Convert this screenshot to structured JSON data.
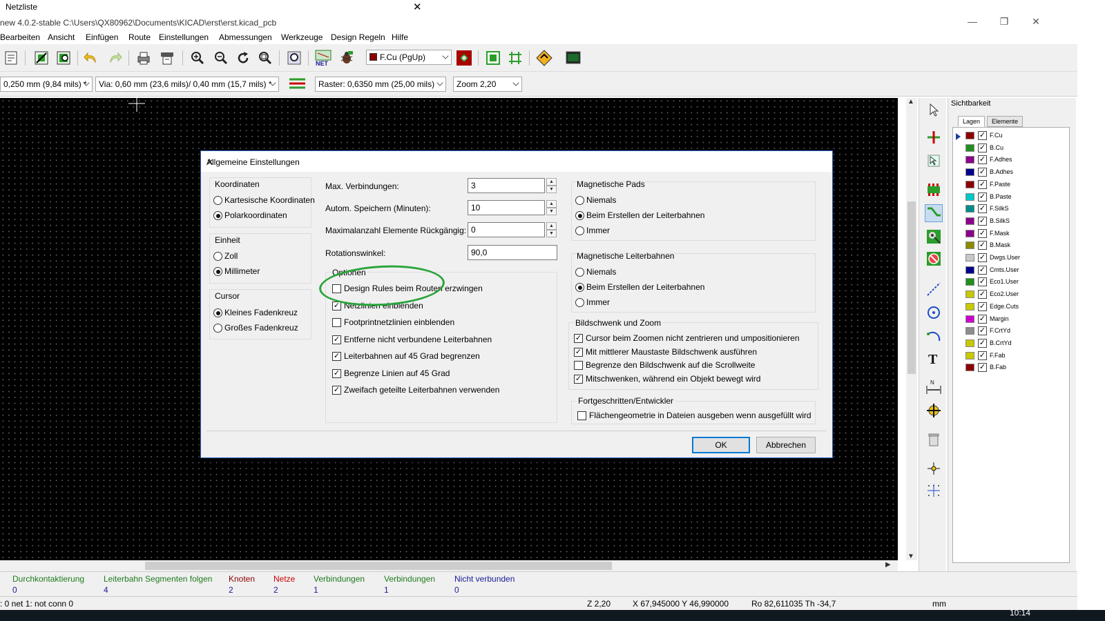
{
  "netzliste_window": {
    "title": "Netzliste",
    "close": "✕"
  },
  "window": {
    "title": "new 4.0.2-stable C:\\Users\\QX80962\\Documents\\KICAD\\erst\\erst.kicad_pcb",
    "minimize": "—",
    "restore": "❐",
    "close": "✕"
  },
  "menu": [
    "Bearbeiten",
    "Ansicht",
    "Einfügen",
    "Route",
    "Einstellungen",
    "Abmessungen",
    "Werkzeuge",
    "Design Regeln",
    "Hilfe"
  ],
  "toolbar1": {
    "layer_select": "F.Cu (PgUp)",
    "layer_color": "#8b0000",
    "icons": [
      "page-settings-icon",
      "library-editor-icon",
      "library-browser-icon",
      "undo-icon",
      "redo-icon",
      "print-icon",
      "plot-icon",
      "zoom-in-icon",
      "zoom-out-icon",
      "redraw-icon",
      "zoom-fit-icon",
      "find-icon",
      "netlist-icon",
      "drc-icon",
      "layer-pair-icon",
      "autoplace-icon",
      "grid-icon",
      "autoroute-icon",
      "scripting-console-icon"
    ]
  },
  "toolbar2": {
    "track_width": "0,250 mm (9,84 mils) *",
    "via_size": "Via: 0,60 mm (23,6 mils)/ 0,40 mm (15,7 mils) *",
    "grid": "Raster: 0,6350 mm (25,00 mils)",
    "zoom": "Zoom 2,20"
  },
  "right_tools": [
    "select-arrow-icon",
    "highlight-net-icon",
    "local-ratsnest-icon",
    "add-footprint-icon",
    "route-track-icon",
    "add-via-icon",
    "keepout-icon",
    "graphic-line-icon",
    "circle-icon",
    "arc-icon",
    "text-icon",
    "dimension-icon",
    "target-icon",
    "delete-icon",
    "drill-origin-icon",
    "grid-origin-icon"
  ],
  "layers_panel": {
    "title": "Sichtbarkeit",
    "tabs": [
      "Lagen",
      "Elemente"
    ],
    "layers": [
      {
        "name": "F.Cu",
        "color": "#8b0000"
      },
      {
        "name": "B.Cu",
        "color": "#1f8f1f"
      },
      {
        "name": "F.Adhes",
        "color": "#8b008b"
      },
      {
        "name": "B.Adhes",
        "color": "#00008b"
      },
      {
        "name": "F.Paste",
        "color": "#8b0000"
      },
      {
        "name": "B.Paste",
        "color": "#00c8c8"
      },
      {
        "name": "F.SilkS",
        "color": "#008b8b"
      },
      {
        "name": "B.SilkS",
        "color": "#8b008b"
      },
      {
        "name": "F.Mask",
        "color": "#8b008b"
      },
      {
        "name": "B.Mask",
        "color": "#8b8b00"
      },
      {
        "name": "Dwgs.User",
        "color": "#c8c8c8"
      },
      {
        "name": "Cmts.User",
        "color": "#00008b"
      },
      {
        "name": "Eco1.User",
        "color": "#1f8f1f"
      },
      {
        "name": "Eco2.User",
        "color": "#c8c800"
      },
      {
        "name": "Edge.Cuts",
        "color": "#c8c800"
      },
      {
        "name": "Margin",
        "color": "#c800c8"
      },
      {
        "name": "F.CrtYd",
        "color": "#8c8c8c"
      },
      {
        "name": "B.CrtYd",
        "color": "#c8c800"
      },
      {
        "name": "F.Fab",
        "color": "#c8c800"
      },
      {
        "name": "B.Fab",
        "color": "#8b0000"
      }
    ]
  },
  "status_bar": {
    "cells": [
      {
        "label": "Durchkontaktierung",
        "value": "0",
        "color": "#1e7a1e"
      },
      {
        "label": "Leiterbahn Segmenten folgen",
        "value": "4",
        "color": "#1e7a1e"
      },
      {
        "label": "Knoten",
        "value": "2",
        "color": "#8b0000"
      },
      {
        "label": "Netze",
        "value": "2",
        "color": "#cc0000"
      },
      {
        "label": "Verbindungen",
        "value": "1",
        "color": "#1e7a1e"
      },
      {
        "label": "Verbindungen",
        "value": "1",
        "color": "#1e7a1e"
      },
      {
        "label": "Nicht verbunden",
        "value": "0",
        "color": "#1a1a99"
      }
    ],
    "line2_left": ": 0  net 1: not conn 0",
    "zoom": "Z 2,20",
    "coords": "X 67,945000  Y 46,990000",
    "polar": "Ro 82,611035  Th -34,7",
    "units": "mm"
  },
  "taskbar": {
    "clock": "10:14"
  },
  "dialog": {
    "title": "Allgemeine Einstellungen",
    "close": "✕",
    "koordinaten": {
      "title": "Koordinaten",
      "options": [
        "Kartesische Koordinaten",
        "Polarkoordinaten"
      ],
      "selected": 1
    },
    "einheit": {
      "title": "Einheit",
      "options": [
        "Zoll",
        "Millimeter"
      ],
      "selected": 1
    },
    "cursor": {
      "title": "Cursor",
      "options": [
        "Kleines Fadenkreuz",
        "Großes Fadenkreuz"
      ],
      "selected": 0
    },
    "fields": [
      {
        "label": "Max. Verbindungen:",
        "value": "3",
        "spin": true
      },
      {
        "label": "Autom. Speichern (Minuten):",
        "value": "10",
        "spin": true
      },
      {
        "label": "Maximalanzahl Elemente Rückgängig:",
        "value": "0",
        "spin": true
      },
      {
        "label": "Rotationswinkel:",
        "value": "90,0",
        "spin": false
      }
    ],
    "optionen": {
      "title": "Optionen",
      "items": [
        {
          "label": "Design Rules beim Routen erzwingen",
          "checked": false
        },
        {
          "label": "Netzlinien einblenden",
          "checked": true
        },
        {
          "label": "Footprintnetzlinien einblenden",
          "checked": false
        },
        {
          "label": "Entferne nicht verbundene Leiterbahnen",
          "checked": true
        },
        {
          "label": "Leiterbahnen auf 45 Grad begrenzen",
          "checked": true
        },
        {
          "label": "Begrenze Linien auf 45 Grad",
          "checked": true
        },
        {
          "label": "Zweifach geteilte Leiterbahnen verwenden",
          "checked": true
        }
      ]
    },
    "mag_pads": {
      "title": "Magnetische Pads",
      "options": [
        "Niemals",
        "Beim Erstellen der Leiterbahnen",
        "Immer"
      ],
      "selected": 1
    },
    "mag_tracks": {
      "title": "Magnetische Leiterbahnen",
      "options": [
        "Niemals",
        "Beim Erstellen der Leiterbahnen",
        "Immer"
      ],
      "selected": 1
    },
    "pan_zoom": {
      "title": "Bildschwenk und Zoom",
      "items": [
        {
          "label": "Cursor beim Zoomen nicht zentrieren und umpositionieren",
          "checked": true
        },
        {
          "label": "Mit mittlerer Maustaste Bildschwenk ausführen",
          "checked": true
        },
        {
          "label": "Begrenze den Bildschwenk auf die Scrollweite",
          "checked": false
        },
        {
          "label": "Mitschwenken, während ein Objekt bewegt wird",
          "checked": true
        }
      ]
    },
    "advanced": {
      "title": "Fortgeschritten/Entwickler",
      "items": [
        {
          "label": "Flächengeometrie in Dateien ausgeben wenn ausgefüllt wird",
          "checked": false
        }
      ]
    },
    "ok": "OK",
    "cancel": "Abbrechen"
  }
}
